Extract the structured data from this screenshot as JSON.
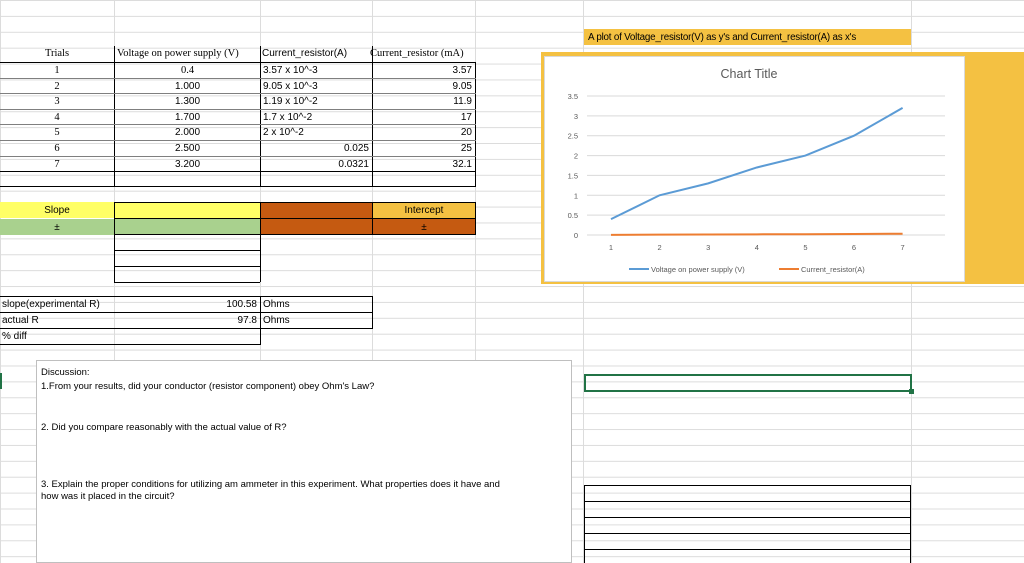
{
  "table": {
    "headers": [
      "Trials",
      "Voltage on power supply (V)",
      "Current_resistor(A)",
      "Current_resistor (mA)"
    ],
    "rows": [
      {
        "trial": "1",
        "voltage": "0.4",
        "current_a": "3.57 x 10^-3",
        "current_ma": "3.57"
      },
      {
        "trial": "2",
        "voltage": "1.000",
        "current_a": "9.05 x 10^-3",
        "current_ma": "9.05"
      },
      {
        "trial": "3",
        "voltage": "1.300",
        "current_a": "1.19 x 10^-2",
        "current_ma": "11.9"
      },
      {
        "trial": "4",
        "voltage": "1.700",
        "current_a": "1.7 x 10^-2",
        "current_ma": "17"
      },
      {
        "trial": "5",
        "voltage": "2.000",
        "current_a": "2 x 10^-2",
        "current_ma": "20"
      },
      {
        "trial": "6",
        "voltage": "2.500",
        "current_a": "0.025",
        "current_ma": "25"
      },
      {
        "trial": "7",
        "voltage": "3.200",
        "current_a": "0.0321",
        "current_ma": "32.1"
      }
    ]
  },
  "slope": {
    "label": "Slope",
    "pm": "±"
  },
  "intercept": {
    "label": "Intercept",
    "pm": "±"
  },
  "results": {
    "slope_label": "slope(experimental R)",
    "slope_value": "100.58",
    "slope_unit": "Ohms",
    "actual_label": "actual R",
    "actual_value": "97.8",
    "actual_unit": "Ohms",
    "diff_label": "% diff"
  },
  "discussion": {
    "title": "Discussion:",
    "q1": "1.From your results, did your conductor (resistor component) obey Ohm's Law?",
    "q2": "2. Did you compare reasonably with the actual value of R?",
    "q3_line1": "3. Explain the proper conditions for utilizing am ammeter in this experiment. What properties does it have and",
    "q3_line2": "how was it placed in the circuit?"
  },
  "plot_caption": "A plot of Voltage_resistor(V) as y's and Current_resistor(A) as x's",
  "colors": {
    "yellow": "#ffff66",
    "green": "#a9d18e",
    "orange": "#c55a11",
    "gold": "#f4c142",
    "blue": "#5b9bd5",
    "series2": "#ed7d31"
  },
  "chart_data": {
    "type": "line",
    "title": "Chart Title",
    "categories": [
      "1",
      "2",
      "3",
      "4",
      "5",
      "6",
      "7"
    ],
    "ylim": [
      0,
      3.5
    ],
    "yticks": [
      "0",
      "0.5",
      "1",
      "1.5",
      "2",
      "2.5",
      "3",
      "3.5"
    ],
    "series": [
      {
        "name": "Voltage on power supply (V)",
        "values": [
          0.4,
          1.0,
          1.3,
          1.7,
          2.0,
          2.5,
          3.2
        ]
      },
      {
        "name": "Current_resistor(A)",
        "values": [
          0.00357,
          0.00905,
          0.0119,
          0.017,
          0.02,
          0.025,
          0.0321
        ]
      }
    ],
    "legend_position": "bottom",
    "grid": true
  }
}
